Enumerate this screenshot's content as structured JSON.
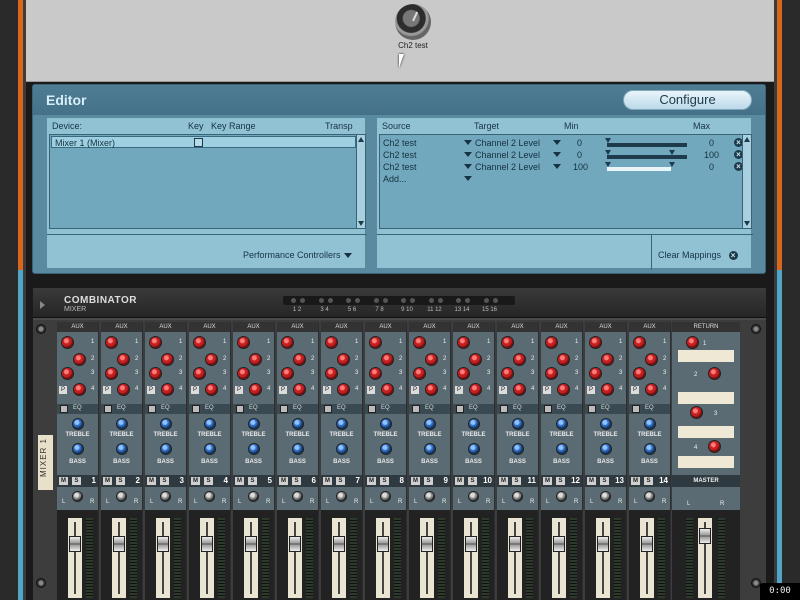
{
  "top_panel": {
    "knob_label": "Ch2 test"
  },
  "editor": {
    "title": "Editor",
    "configure_label": "Configure",
    "left_headers": {
      "device": "Device:",
      "key": "Key",
      "key_range": "Key Range",
      "transp": "Transp"
    },
    "devices": [
      {
        "name": "Mixer 1 (Mixer)"
      }
    ],
    "performance_controllers_label": "Performance Controllers",
    "right_headers": {
      "source": "Source",
      "target": "Target",
      "min": "Min",
      "max": "Max"
    },
    "mappings": [
      {
        "source": "Ch2 test",
        "target": "Channel 2 Level",
        "min": "0",
        "max": "0"
      },
      {
        "source": "Ch2 test",
        "target": "Channel 2 Level",
        "min": "0",
        "max": "100"
      },
      {
        "source": "Ch2 test",
        "target": "Channel 2 Level",
        "min": "100",
        "max": "0"
      }
    ],
    "add_label": "Add...",
    "clear_mappings_label": "Clear Mappings"
  },
  "combinator": {
    "title": "COMBINATOR",
    "subtitle": "MIXER",
    "led_groups": [
      "1 2",
      "3 4",
      "5 6",
      "7 8",
      "9 10",
      "11 12",
      "13 14",
      "15 16"
    ],
    "mixer_tag": "MIXER 1",
    "channel_labels": {
      "aux": "AUX",
      "eq": "EQ",
      "treble": "TREBLE",
      "bass": "BASS",
      "mute": "M",
      "solo": "S",
      "pre": "P",
      "left": "L",
      "right": "R"
    },
    "aux_numbers": [
      "1",
      "2",
      "3",
      "4"
    ],
    "channels": [
      "1",
      "2",
      "3",
      "4",
      "5",
      "6",
      "7",
      "8",
      "9",
      "10",
      "11",
      "12",
      "13",
      "14"
    ],
    "return_label": "RETURN",
    "return_numbers": [
      "1",
      "2",
      "3",
      "4"
    ],
    "master_label": "MASTER"
  },
  "timer": "0:00",
  "colors": {
    "rail_orange": "#d8661c",
    "rail_blue": "#4fa6c9",
    "editor_bg": "#5a8aa0",
    "editor_pane": "#90c2d4",
    "channel_strip": "#5b6b74"
  }
}
